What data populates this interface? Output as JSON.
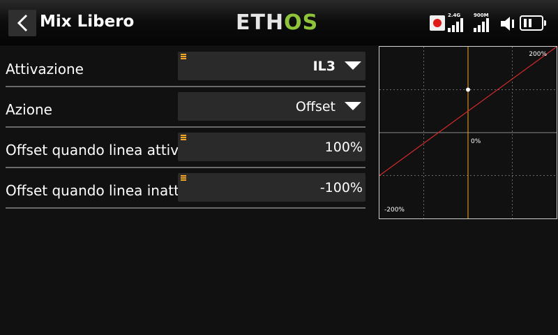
{
  "header": {
    "title": "Mix Libero",
    "logo_main": "ETH",
    "logo_accent": "OS",
    "signal_1_label": "2.4G",
    "signal_2_label": "900M"
  },
  "rows": [
    {
      "label": "Attivazione",
      "value": "IL3",
      "has_dropdown": true,
      "has_menu_icon": true
    },
    {
      "label": "Azione",
      "value": "Offset",
      "has_dropdown": true,
      "has_menu_icon": false
    },
    {
      "label": "Offset quando linea attiv",
      "value": "100%",
      "has_dropdown": false,
      "has_menu_icon": true
    },
    {
      "label": "Offset quando linea inatt",
      "value": "-100%",
      "has_dropdown": false,
      "has_menu_icon": true
    }
  ],
  "chart_data": {
    "type": "line",
    "x": [
      -200,
      200
    ],
    "y": [
      -100,
      200
    ],
    "xlim": [
      -200,
      200
    ],
    "ylim": [
      -200,
      200
    ],
    "marker": {
      "x": 0,
      "y": 100
    },
    "cursor_x": 0,
    "tick_labels": {
      "top_right": "200%",
      "center": "0%",
      "bottom_left": "-200%"
    },
    "line_color": "#d42a2a",
    "cursor_color": "#f5a623",
    "grid": true
  }
}
